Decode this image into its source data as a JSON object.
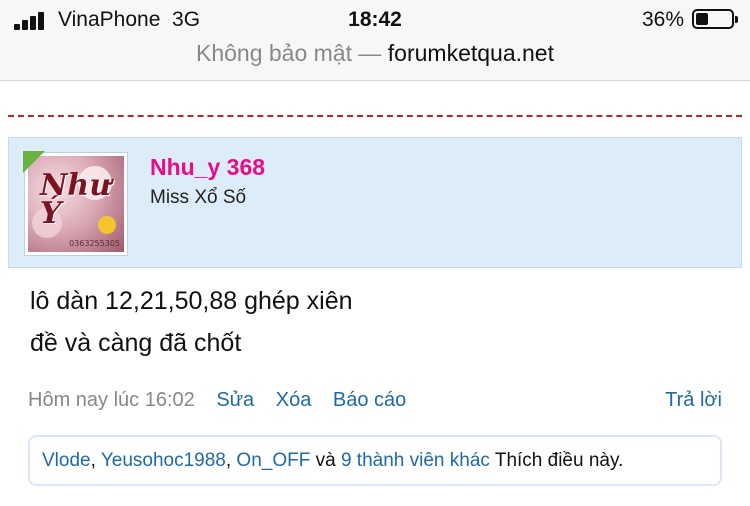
{
  "status_bar": {
    "carrier": "VinaPhone",
    "network": "3G",
    "time": "18:42",
    "battery_percent": "36%",
    "battery_level": 0.36
  },
  "address_bar": {
    "security": "Không bảo mật —",
    "host": "forumketqua.net"
  },
  "post": {
    "author": {
      "name": "Nhu_y 368",
      "title": "Miss Xổ Số",
      "online": true,
      "avatar_text": "Như Ý",
      "avatar_caption": "0363255305"
    },
    "message_lines": [
      "lô dàn 12,21,50,88 ghép xiên",
      "đề và càng đã chốt"
    ],
    "meta": {
      "date": "Hôm nay lúc 16:02",
      "edit": "Sửa",
      "delete": "Xóa",
      "report": "Báo cáo",
      "reply": "Trả lời"
    },
    "likes": {
      "user1": "Vlode",
      "sep1": ", ",
      "user2": "Yeusohoc1988",
      "sep2": ", ",
      "user3": "On_OFF",
      "and": " và ",
      "others": "9 thành viên khác",
      "suffix": " Thích điều này."
    }
  },
  "colors": {
    "accent_link": "#1e6aa8",
    "username": "#ea0a8c",
    "divider": "#c8202b",
    "userblock_bg": "#dcecf8",
    "online": "#67b33e"
  }
}
